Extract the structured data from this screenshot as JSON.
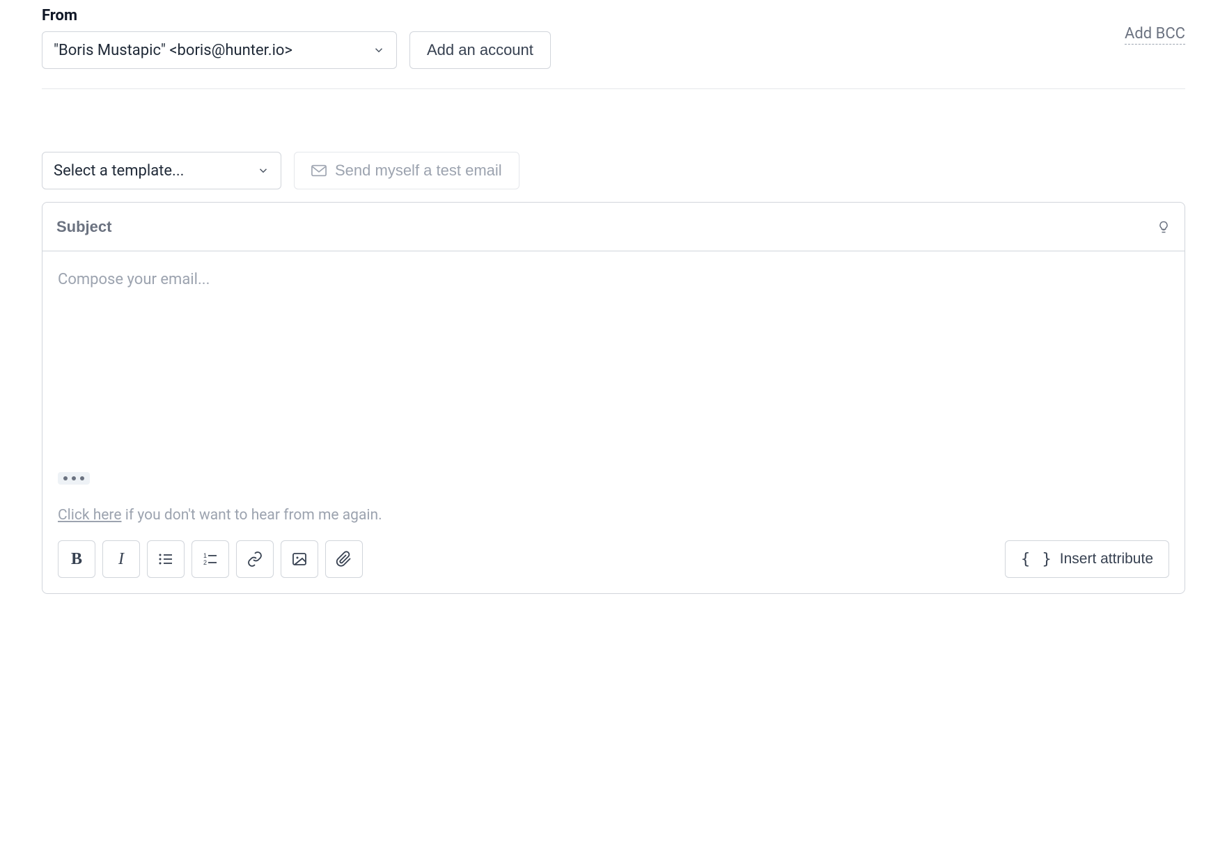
{
  "from": {
    "label": "From",
    "selected": "\"Boris Mustapic\" <boris@hunter.io>",
    "add_account_label": "Add an account",
    "add_bcc_label": "Add BCC"
  },
  "template": {
    "placeholder": "Select a template...",
    "send_test_label": "Send myself a test email"
  },
  "editor": {
    "subject_placeholder": "Subject",
    "compose_placeholder": "Compose your email...",
    "unsubscribe_link_text": "Click here",
    "unsubscribe_rest": " if you don't want to hear from me again."
  },
  "toolbar": {
    "insert_attribute_label": "Insert attribute"
  }
}
